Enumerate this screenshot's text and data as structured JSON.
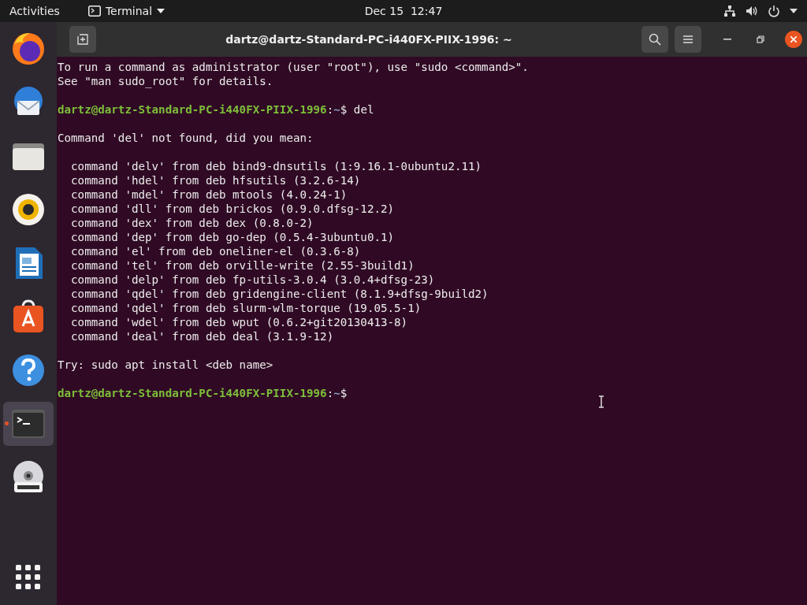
{
  "top_bar": {
    "activities": "Activities",
    "app_menu": "Terminal",
    "clock": "Dec 15  12:47"
  },
  "dock": {
    "items": [
      {
        "kind": "firefox",
        "selected": false,
        "running": false
      },
      {
        "kind": "thunderbird",
        "selected": false,
        "running": false
      },
      {
        "kind": "files",
        "selected": false,
        "running": false
      },
      {
        "kind": "rhythmbox",
        "selected": false,
        "running": false
      },
      {
        "kind": "writer",
        "selected": false,
        "running": false
      },
      {
        "kind": "software",
        "selected": false,
        "running": false
      },
      {
        "kind": "help",
        "selected": false,
        "running": false
      },
      {
        "kind": "terminal",
        "selected": true,
        "running": true
      },
      {
        "kind": "dvd",
        "selected": false,
        "running": false
      }
    ]
  },
  "window": {
    "title": "dartz@dartz-Standard-PC-i440FX-PIIX-1996: ~"
  },
  "terminal": {
    "lines": [
      {
        "kind": "text",
        "text": "To run a command as administrator (user \"root\"), use \"sudo <command>\"."
      },
      {
        "kind": "text",
        "text": "See \"man sudo_root\" for details."
      },
      {
        "kind": "blank"
      },
      {
        "kind": "prompt",
        "user_host": "dartz@dartz-Standard-PC-i440FX-PIIX-1996",
        "separator": ":",
        "path": "~",
        "symbol": "$",
        "command": "del"
      },
      {
        "kind": "blank"
      },
      {
        "kind": "text",
        "text": "Command 'del' not found, did you mean:"
      },
      {
        "kind": "blank"
      },
      {
        "kind": "text",
        "text": "  command 'delv' from deb bind9-dnsutils (1:9.16.1-0ubuntu2.11)"
      },
      {
        "kind": "text",
        "text": "  command 'hdel' from deb hfsutils (3.2.6-14)"
      },
      {
        "kind": "text",
        "text": "  command 'mdel' from deb mtools (4.0.24-1)"
      },
      {
        "kind": "text",
        "text": "  command 'dll' from deb brickos (0.9.0.dfsg-12.2)"
      },
      {
        "kind": "text",
        "text": "  command 'dex' from deb dex (0.8.0-2)"
      },
      {
        "kind": "text",
        "text": "  command 'dep' from deb go-dep (0.5.4-3ubuntu0.1)"
      },
      {
        "kind": "text",
        "text": "  command 'el' from deb oneliner-el (0.3.6-8)"
      },
      {
        "kind": "text",
        "text": "  command 'tel' from deb orville-write (2.55-3build1)"
      },
      {
        "kind": "text",
        "text": "  command 'delp' from deb fp-utils-3.0.4 (3.0.4+dfsg-23)"
      },
      {
        "kind": "text",
        "text": "  command 'qdel' from deb gridengine-client (8.1.9+dfsg-9build2)"
      },
      {
        "kind": "text",
        "text": "  command 'qdel' from deb slurm-wlm-torque (19.05.5-1)"
      },
      {
        "kind": "text",
        "text": "  command 'wdel' from deb wput (0.6.2+git20130413-8)"
      },
      {
        "kind": "text",
        "text": "  command 'deal' from deb deal (3.1.9-12)"
      },
      {
        "kind": "blank"
      },
      {
        "kind": "text",
        "text": "Try: sudo apt install <deb name>"
      },
      {
        "kind": "blank"
      },
      {
        "kind": "prompt",
        "user_host": "dartz@dartz-Standard-PC-i440FX-PIIX-1996",
        "separator": ":",
        "path": "~",
        "symbol": "$"
      }
    ]
  }
}
